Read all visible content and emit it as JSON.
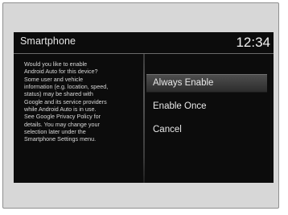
{
  "header": {
    "title": "Smartphone",
    "clock": "12:34"
  },
  "dialog": {
    "message": "Would you like to enable\nAndroid Auto for this device?\nSome user and vehicle\ninformation (e.g. location, speed,\nstatus) may be shared with\nGoogle and its service providers\nwhile Android Auto is in use.\nSee Google Privacy Policy for\ndetails. You may change your\nselection later under the\nSmartphone Settings menu.",
    "options": [
      {
        "label": "Always Enable",
        "selected": true
      },
      {
        "label": "Enable Once",
        "selected": false
      },
      {
        "label": "Cancel",
        "selected": false
      }
    ]
  },
  "colors": {
    "screen_background": "#0c0c0c",
    "text": "#e8e8e8",
    "highlight": "#4e4e4e",
    "bezel": "#d7d7d7"
  }
}
